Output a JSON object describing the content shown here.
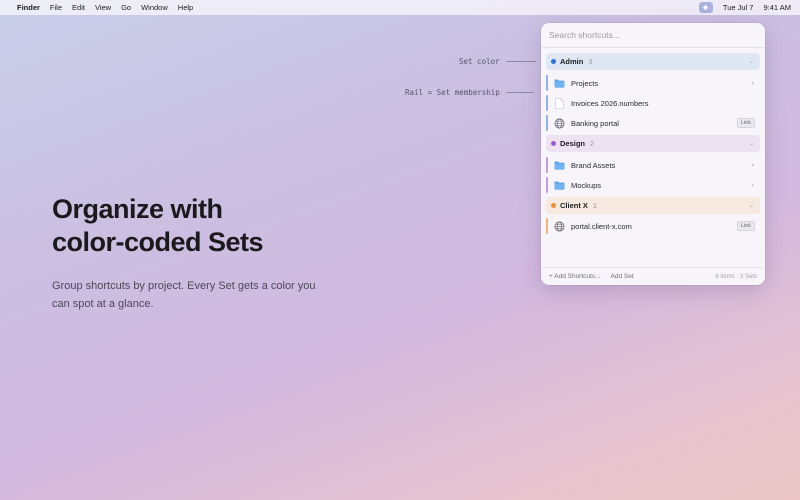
{
  "menubar": {
    "app": "Finder",
    "menus": [
      "File",
      "Edit",
      "View",
      "Go",
      "Window",
      "Help"
    ],
    "date": "Tue Jul 7",
    "time": "9:41 AM",
    "status_icon": "shortcuts-status-icon"
  },
  "hero": {
    "title_line1": "Organize with",
    "title_line2": "color-coded Sets",
    "subtitle": "Group shortcuts by project. Every Set gets a color you can spot at a glance."
  },
  "callouts": {
    "set_color": "Set color",
    "rail": "Rail = Set membership"
  },
  "popover": {
    "search_placeholder": "Search shortcuts...",
    "sets": [
      {
        "name": "Admin",
        "count": "3",
        "color": "#2f6fe0",
        "tint": "#dfe7f4",
        "items": [
          {
            "label": "Projects",
            "icon": "folder-icon",
            "trailing": "›"
          },
          {
            "label": "Invoices 2026.numbers",
            "icon": "document-icon",
            "trailing": ""
          },
          {
            "label": "Banking portal",
            "icon": "globe-icon",
            "trailing": "Link"
          }
        ]
      },
      {
        "name": "Design",
        "count": "2",
        "color": "#9b5bd6",
        "tint": "#ece2f1",
        "items": [
          {
            "label": "Brand Assets",
            "icon": "folder-icon",
            "trailing": "›"
          },
          {
            "label": "Mockups",
            "icon": "folder-icon",
            "trailing": "›"
          }
        ]
      },
      {
        "name": "Client X",
        "count": "1",
        "color": "#f0902e",
        "tint": "#f6e9df",
        "items": [
          {
            "label": "portal.client-x.com",
            "icon": "globe-icon",
            "trailing": "Link"
          }
        ]
      }
    ],
    "footer": {
      "add_shortcuts": "+ Add Shortcuts...",
      "add_set": "Add Set",
      "summary": "6 items · 3 Sets"
    }
  },
  "colors": {
    "accent": "#2f6fe0",
    "admin": "#2f6fe0",
    "design": "#9b5bd6",
    "client_x": "#f0902e"
  }
}
